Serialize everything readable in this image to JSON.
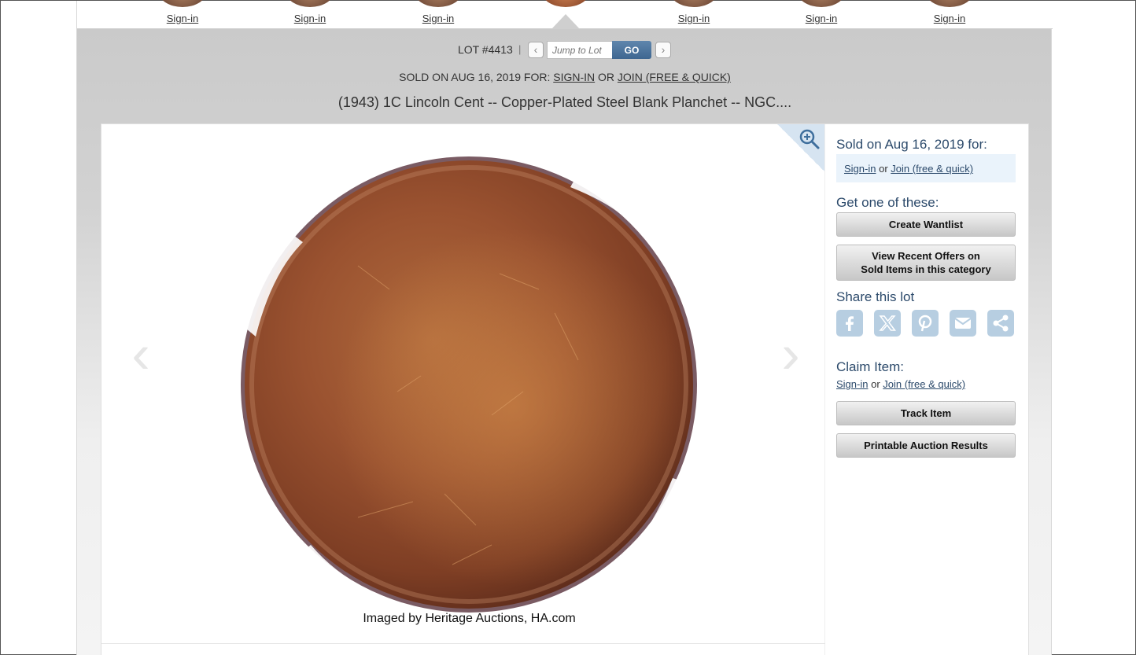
{
  "thumbnails": [
    {
      "label": "Sign-in"
    },
    {
      "label": "Sign-in"
    },
    {
      "label": "Sign-in"
    },
    {
      "label": ""
    },
    {
      "label": "Sign-in"
    },
    {
      "label": "Sign-in"
    },
    {
      "label": "Sign-in"
    }
  ],
  "lot_nav": {
    "lot_label": "LOT #4413",
    "separator": "|",
    "prev_icon": "‹",
    "next_icon": "›",
    "jump_placeholder": "Jump to Lot",
    "go_label": "GO"
  },
  "sold_line": {
    "prefix": "SOLD ON AUG 16, 2019 FOR:",
    "signin": "SIGN-IN",
    "or": "OR",
    "join": "JOIN (FREE & QUICK)"
  },
  "lot_title": "(1943) 1C Lincoln Cent -- Copper-Plated Steel Blank Planchet -- NGC....",
  "image": {
    "credit": "Imaged by Heritage Auctions, HA.com",
    "prev_arrow": "‹",
    "next_arrow": "›",
    "zoom_icon": "zoom-in-icon"
  },
  "sidebar": {
    "sold_heading": "Sold on Aug 16, 2019 for:",
    "signin": "Sign-in",
    "or": "or",
    "join": "Join (free & quick)",
    "get_heading": "Get one of these:",
    "create_wantlist": "Create Wantlist",
    "recent_offers_line1": "View Recent Offers on",
    "recent_offers_line2": "Sold Items in this category",
    "share_heading": "Share this lot",
    "share_icons": [
      "facebook-icon",
      "x-icon",
      "pinterest-icon",
      "email-icon",
      "share-icon"
    ],
    "claim_heading": "Claim Item:",
    "claim_signin": "Sign-in",
    "claim_or": "or",
    "claim_join": "Join (free & quick)",
    "track_item": "Track Item",
    "printable_results": "Printable Auction Results"
  },
  "colors": {
    "accent": "#2c4a6b",
    "go_button": "#4a729b",
    "share_icon_bg": "#b7cee1",
    "login_box_bg": "#eaf3fb"
  }
}
